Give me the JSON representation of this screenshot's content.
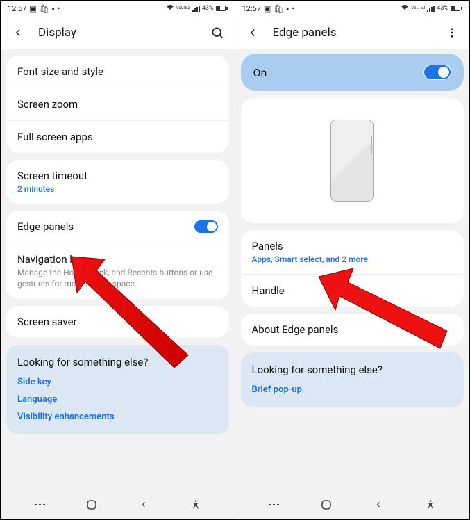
{
  "status": {
    "time": "12:57",
    "battery_pct": "43%",
    "net_label": "VoLTE2"
  },
  "left": {
    "header_title": "Display",
    "rows": {
      "font": "Font size and style",
      "zoom": "Screen zoom",
      "fullscreen": "Full screen apps",
      "timeout_title": "Screen timeout",
      "timeout_val": "2 minutes",
      "edge": "Edge panels",
      "navbar_title": "Navigation bar",
      "navbar_sub": "Manage the Home, Back, and Recents buttons or use gestures for more screen space.",
      "screensaver": "Screen saver"
    },
    "footer": {
      "title": "Looking for something else?",
      "links": [
        "Side key",
        "Language",
        "Visibility enhancements"
      ]
    }
  },
  "right": {
    "header_title": "Edge panels",
    "on_label": "On",
    "rows": {
      "panels_title": "Panels",
      "panels_sub": "Apps, Smart select, and 2 more",
      "handle": "Handle",
      "about": "About Edge panels"
    },
    "footer": {
      "title": "Looking for something else?",
      "links": [
        "Brief pop-up"
      ]
    }
  }
}
